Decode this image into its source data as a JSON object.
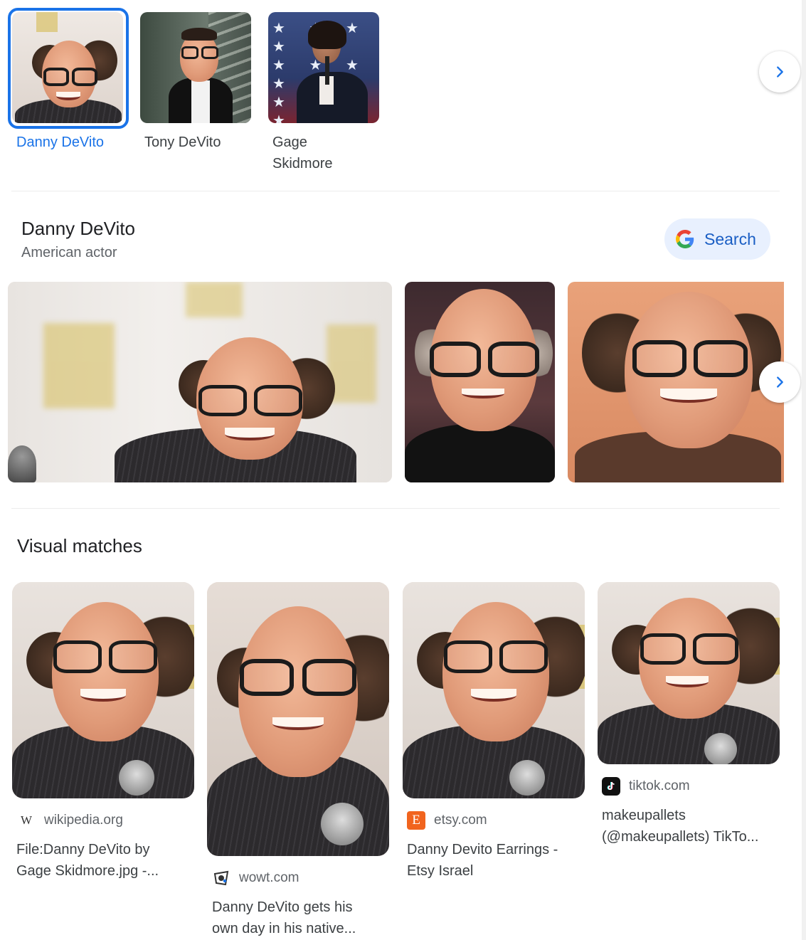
{
  "entity_chips": [
    {
      "label": "Danny DeVito",
      "selected": true
    },
    {
      "label": "Tony DeVito",
      "selected": false
    },
    {
      "label": "Gage Skidmore",
      "selected": false
    }
  ],
  "knowledge_panel": {
    "title": "Danny DeVito",
    "subtitle": "American actor",
    "search_label": "Search"
  },
  "visual_matches": {
    "title": "Visual matches",
    "items": [
      {
        "source": "wikipedia.org",
        "source_icon": "wikipedia-icon",
        "title_line1": "File:Danny DeVito by",
        "title_line2": "Gage Skidmore.jpg -..."
      },
      {
        "source": "wowt.com",
        "source_icon": "wowt-icon",
        "title_line1": "Danny DeVito gets his",
        "title_line2": "own day in his native..."
      },
      {
        "source": "etsy.com",
        "source_icon": "etsy-icon",
        "title_line1": "Danny Devito Earrings -",
        "title_line2": "Etsy Israel"
      },
      {
        "source": "tiktok.com",
        "source_icon": "tiktok-icon",
        "title_line1": "makeupallets",
        "title_line2": "(@makeupallets) TikTo..."
      }
    ]
  },
  "icons": {
    "next_arrow": "chevron-right-icon",
    "google": "google-g-icon"
  },
  "colors": {
    "accent": "#1a73e8",
    "search_pill_bg": "#e8f0fe",
    "etsy": "#f1641e"
  }
}
